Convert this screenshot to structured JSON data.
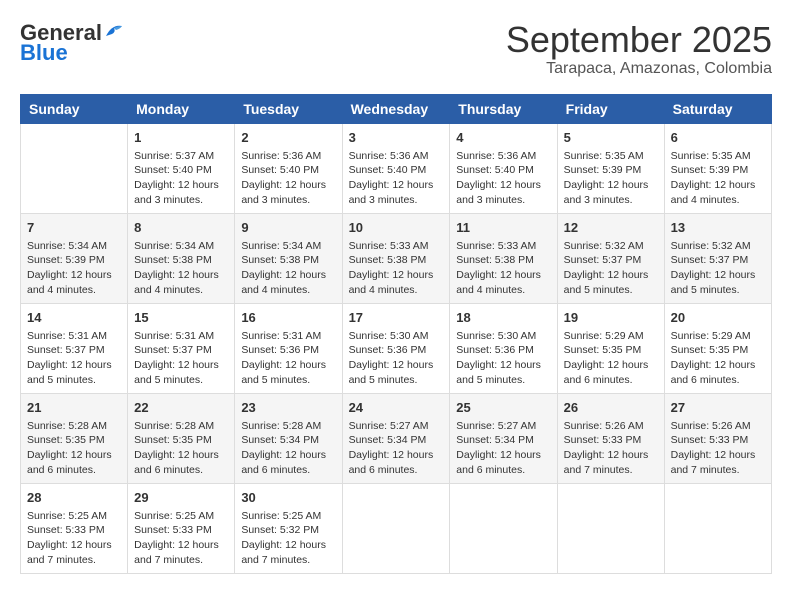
{
  "logo": {
    "line1": "General",
    "line2": "Blue",
    "icon_label": "general-blue-logo"
  },
  "title": "September 2025",
  "subtitle": "Tarapaca, Amazonas, Colombia",
  "days": [
    "Sunday",
    "Monday",
    "Tuesday",
    "Wednesday",
    "Thursday",
    "Friday",
    "Saturday"
  ],
  "weeks": [
    [
      {
        "day": "",
        "info": ""
      },
      {
        "day": "1",
        "info": "Sunrise: 5:37 AM\nSunset: 5:40 PM\nDaylight: 12 hours\nand 3 minutes."
      },
      {
        "day": "2",
        "info": "Sunrise: 5:36 AM\nSunset: 5:40 PM\nDaylight: 12 hours\nand 3 minutes."
      },
      {
        "day": "3",
        "info": "Sunrise: 5:36 AM\nSunset: 5:40 PM\nDaylight: 12 hours\nand 3 minutes."
      },
      {
        "day": "4",
        "info": "Sunrise: 5:36 AM\nSunset: 5:40 PM\nDaylight: 12 hours\nand 3 minutes."
      },
      {
        "day": "5",
        "info": "Sunrise: 5:35 AM\nSunset: 5:39 PM\nDaylight: 12 hours\nand 3 minutes."
      },
      {
        "day": "6",
        "info": "Sunrise: 5:35 AM\nSunset: 5:39 PM\nDaylight: 12 hours\nand 4 minutes."
      }
    ],
    [
      {
        "day": "7",
        "info": "Sunrise: 5:34 AM\nSunset: 5:39 PM\nDaylight: 12 hours\nand 4 minutes."
      },
      {
        "day": "8",
        "info": "Sunrise: 5:34 AM\nSunset: 5:38 PM\nDaylight: 12 hours\nand 4 minutes."
      },
      {
        "day": "9",
        "info": "Sunrise: 5:34 AM\nSunset: 5:38 PM\nDaylight: 12 hours\nand 4 minutes."
      },
      {
        "day": "10",
        "info": "Sunrise: 5:33 AM\nSunset: 5:38 PM\nDaylight: 12 hours\nand 4 minutes."
      },
      {
        "day": "11",
        "info": "Sunrise: 5:33 AM\nSunset: 5:38 PM\nDaylight: 12 hours\nand 4 minutes."
      },
      {
        "day": "12",
        "info": "Sunrise: 5:32 AM\nSunset: 5:37 PM\nDaylight: 12 hours\nand 5 minutes."
      },
      {
        "day": "13",
        "info": "Sunrise: 5:32 AM\nSunset: 5:37 PM\nDaylight: 12 hours\nand 5 minutes."
      }
    ],
    [
      {
        "day": "14",
        "info": "Sunrise: 5:31 AM\nSunset: 5:37 PM\nDaylight: 12 hours\nand 5 minutes."
      },
      {
        "day": "15",
        "info": "Sunrise: 5:31 AM\nSunset: 5:37 PM\nDaylight: 12 hours\nand 5 minutes."
      },
      {
        "day": "16",
        "info": "Sunrise: 5:31 AM\nSunset: 5:36 PM\nDaylight: 12 hours\nand 5 minutes."
      },
      {
        "day": "17",
        "info": "Sunrise: 5:30 AM\nSunset: 5:36 PM\nDaylight: 12 hours\nand 5 minutes."
      },
      {
        "day": "18",
        "info": "Sunrise: 5:30 AM\nSunset: 5:36 PM\nDaylight: 12 hours\nand 5 minutes."
      },
      {
        "day": "19",
        "info": "Sunrise: 5:29 AM\nSunset: 5:35 PM\nDaylight: 12 hours\nand 6 minutes."
      },
      {
        "day": "20",
        "info": "Sunrise: 5:29 AM\nSunset: 5:35 PM\nDaylight: 12 hours\nand 6 minutes."
      }
    ],
    [
      {
        "day": "21",
        "info": "Sunrise: 5:28 AM\nSunset: 5:35 PM\nDaylight: 12 hours\nand 6 minutes."
      },
      {
        "day": "22",
        "info": "Sunrise: 5:28 AM\nSunset: 5:35 PM\nDaylight: 12 hours\nand 6 minutes."
      },
      {
        "day": "23",
        "info": "Sunrise: 5:28 AM\nSunset: 5:34 PM\nDaylight: 12 hours\nand 6 minutes."
      },
      {
        "day": "24",
        "info": "Sunrise: 5:27 AM\nSunset: 5:34 PM\nDaylight: 12 hours\nand 6 minutes."
      },
      {
        "day": "25",
        "info": "Sunrise: 5:27 AM\nSunset: 5:34 PM\nDaylight: 12 hours\nand 6 minutes."
      },
      {
        "day": "26",
        "info": "Sunrise: 5:26 AM\nSunset: 5:33 PM\nDaylight: 12 hours\nand 7 minutes."
      },
      {
        "day": "27",
        "info": "Sunrise: 5:26 AM\nSunset: 5:33 PM\nDaylight: 12 hours\nand 7 minutes."
      }
    ],
    [
      {
        "day": "28",
        "info": "Sunrise: 5:25 AM\nSunset: 5:33 PM\nDaylight: 12 hours\nand 7 minutes."
      },
      {
        "day": "29",
        "info": "Sunrise: 5:25 AM\nSunset: 5:33 PM\nDaylight: 12 hours\nand 7 minutes."
      },
      {
        "day": "30",
        "info": "Sunrise: 5:25 AM\nSunset: 5:32 PM\nDaylight: 12 hours\nand 7 minutes."
      },
      {
        "day": "",
        "info": ""
      },
      {
        "day": "",
        "info": ""
      },
      {
        "day": "",
        "info": ""
      },
      {
        "day": "",
        "info": ""
      }
    ]
  ]
}
